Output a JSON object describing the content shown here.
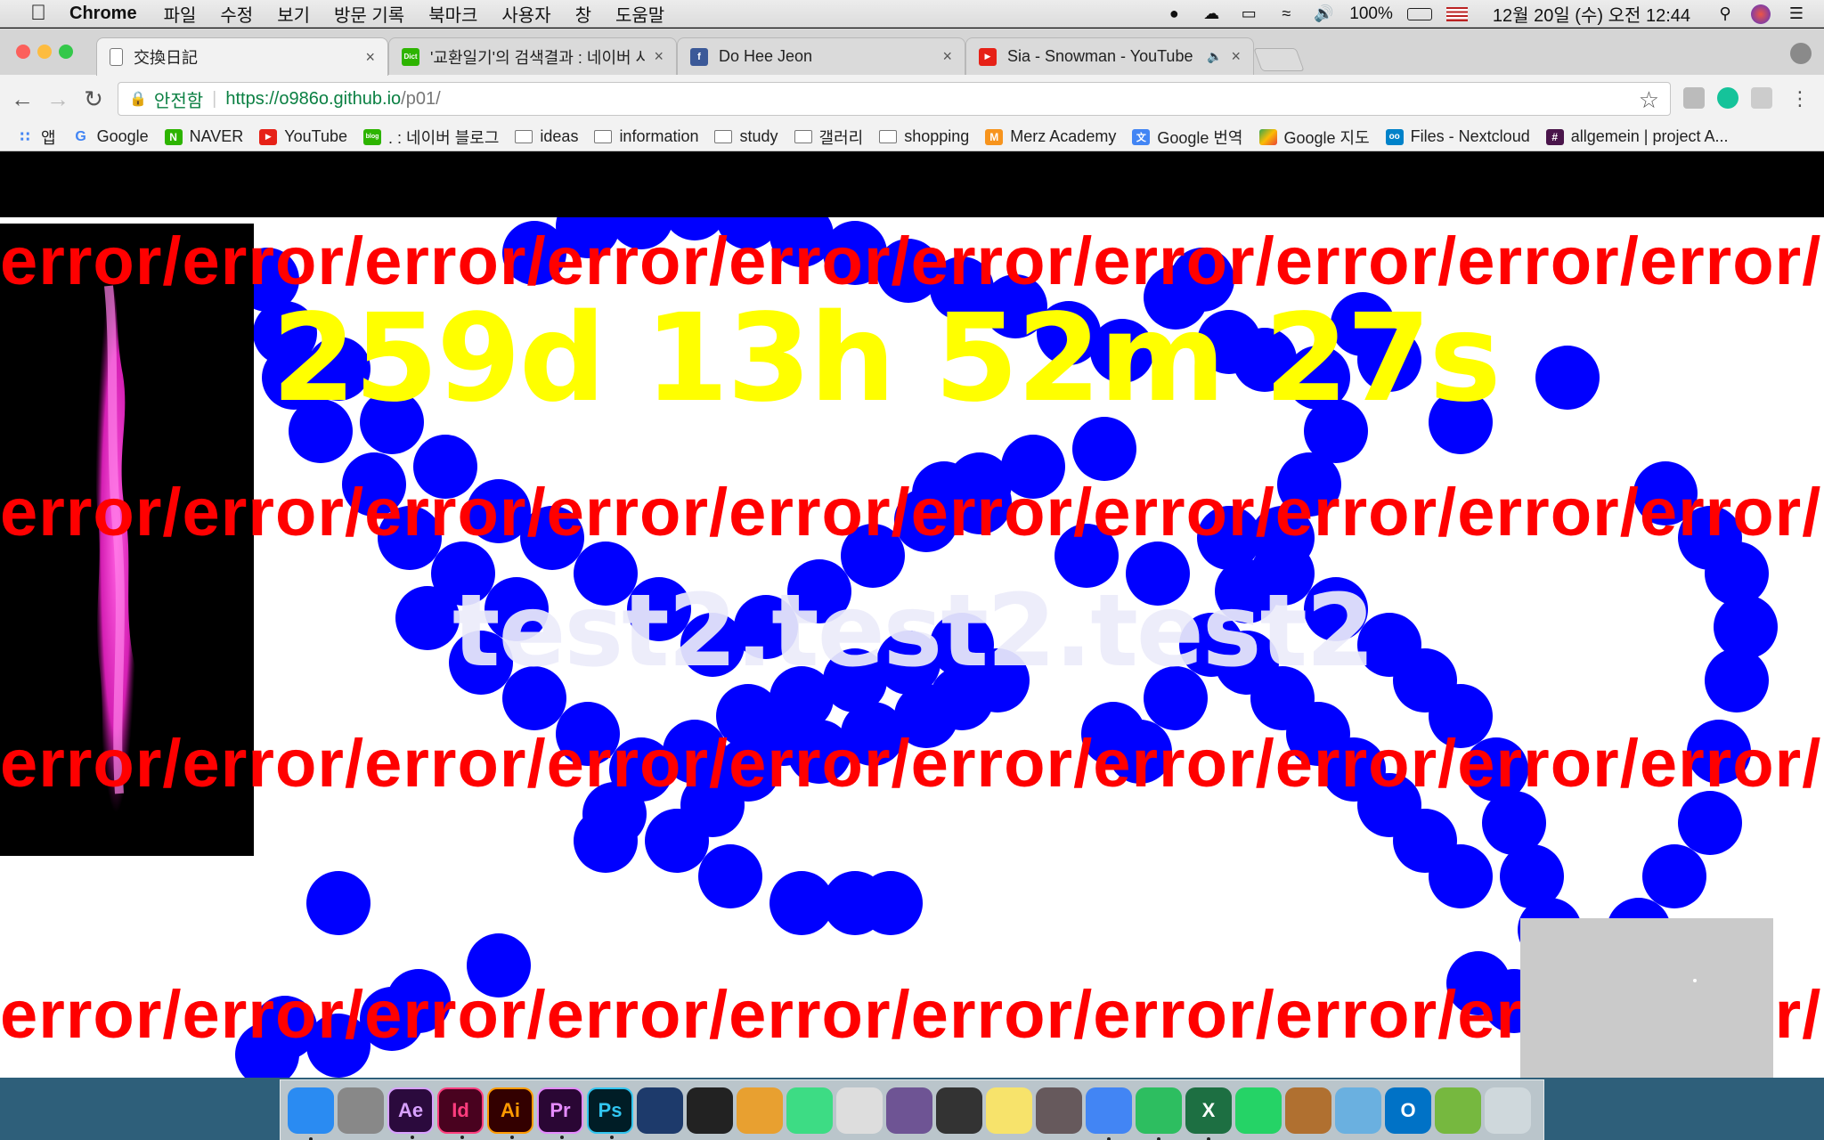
{
  "menubar": {
    "app_name": "Chrome",
    "menus": [
      "파일",
      "수정",
      "보기",
      "방문 기록",
      "북마크",
      "사용자",
      "창",
      "도움말"
    ],
    "battery": "100%",
    "datetime": "12월 20일 (수) 오전 12:44"
  },
  "tabs": [
    {
      "title": "交換日記",
      "active": true
    },
    {
      "title": "'교환일기'의 검색결과 : 네이버 사전",
      "active": false,
      "favicon_label": "Dict"
    },
    {
      "title": "Do Hee Jeon",
      "active": false
    },
    {
      "title": "Sia - Snowman - YouTube",
      "active": false
    }
  ],
  "omnibox": {
    "secure_label": "안전함",
    "url_host": "https://o986o.github.io",
    "url_path": "/p01/"
  },
  "bookmarks": [
    {
      "label": "앱",
      "icon": "apps-grid-icon"
    },
    {
      "label": "Google",
      "icon": "google-icon"
    },
    {
      "label": "NAVER",
      "icon": "naver-icon"
    },
    {
      "label": "YouTube",
      "icon": "youtube-icon"
    },
    {
      "label": ". : 네이버 블로그",
      "icon": "naver-blog-icon"
    },
    {
      "label": "ideas",
      "icon": "folder-icon"
    },
    {
      "label": "information",
      "icon": "folder-icon"
    },
    {
      "label": "study",
      "icon": "folder-icon"
    },
    {
      "label": "갤러리",
      "icon": "folder-icon"
    },
    {
      "label": "shopping",
      "icon": "folder-icon"
    },
    {
      "label": "Merz Academy",
      "icon": "merz-icon"
    },
    {
      "label": "Google 번역",
      "icon": "google-translate-icon"
    },
    {
      "label": "Google 지도",
      "icon": "google-maps-icon"
    },
    {
      "label": "Files - Nextcloud",
      "icon": "nextcloud-icon"
    },
    {
      "label": "allgemein | project A...",
      "icon": "slack-icon"
    }
  ],
  "page": {
    "error_text": "error/error/error/error/error/error/error/error/error/error/",
    "timer": "259d 13h 52m 27s",
    "subtitle": "test2.test2.test2",
    "colors": {
      "error": "#ff0000",
      "timer": "#ffff00",
      "blob": "#0000ff",
      "background": "#ffffff"
    }
  },
  "dock": [
    {
      "name": "finder",
      "label": ""
    },
    {
      "name": "launchpad",
      "label": ""
    },
    {
      "name": "after-effects",
      "label": "Ae"
    },
    {
      "name": "indesign",
      "label": "Id"
    },
    {
      "name": "illustrator",
      "label": "Ai"
    },
    {
      "name": "premiere",
      "label": "Pr"
    },
    {
      "name": "photoshop",
      "label": "Ps"
    },
    {
      "name": "cinema4d",
      "label": ""
    },
    {
      "name": "unity",
      "label": ""
    },
    {
      "name": "cocktail",
      "label": ""
    },
    {
      "name": "android-studio",
      "label": ""
    },
    {
      "name": "sequel-pro",
      "label": ""
    },
    {
      "name": "github-desktop",
      "label": ""
    },
    {
      "name": "processing",
      "label": ""
    },
    {
      "name": "notes",
      "label": ""
    },
    {
      "name": "atom",
      "label": ""
    },
    {
      "name": "chrome",
      "label": ""
    },
    {
      "name": "evernote",
      "label": ""
    },
    {
      "name": "excel",
      "label": "X"
    },
    {
      "name": "whatsapp",
      "label": ""
    },
    {
      "name": "garageband",
      "label": ""
    },
    {
      "name": "preview",
      "label": ""
    },
    {
      "name": "outlook",
      "label": "O"
    },
    {
      "name": "utorrent",
      "label": ""
    },
    {
      "name": "trash",
      "label": ""
    }
  ]
}
